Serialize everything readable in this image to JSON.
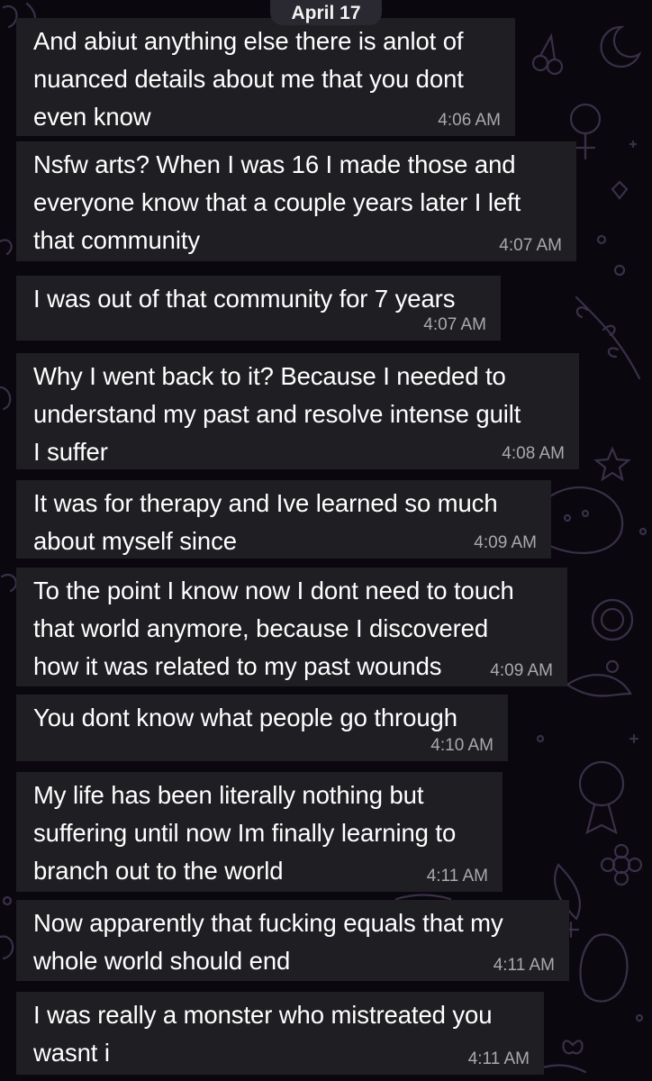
{
  "date_separator": "April 17",
  "messages": [
    {
      "text": "And abiut anything else there is anlot of\nnuanced details about me that you dont\neven know",
      "time": "4:06 AM"
    },
    {
      "text": "Nsfw arts? When I was 16 I made those and\neveryone know that a couple years later I left\nthat community",
      "time": "4:07 AM"
    },
    {
      "text": "I was out of that community for 7 years",
      "time": "4:07 AM"
    },
    {
      "text": "Why I went back to it? Because I needed to\nunderstand my past and resolve intense guilt\nI suffer",
      "time": "4:08 AM"
    },
    {
      "text": "It was for therapy and Ive learned so much\nabout myself since",
      "time": "4:09 AM"
    },
    {
      "text": "To the point I know now I dont need to touch\nthat world anymore, because I discovered\nhow it was related to my past wounds",
      "time": "4:09 AM"
    },
    {
      "text": "You dont know what people go through",
      "time": "4:10 AM"
    },
    {
      "text": "My life has been literally nothing but\nsuffering until now Im finally learning to\nbranch out to the world",
      "time": "4:11 AM"
    },
    {
      "text": "Now apparently that fucking equals that my\nwhole world should end",
      "time": "4:11 AM"
    },
    {
      "text": "I was really a monster who mistreated you\nwasnt i",
      "time": "4:11 AM"
    }
  ]
}
